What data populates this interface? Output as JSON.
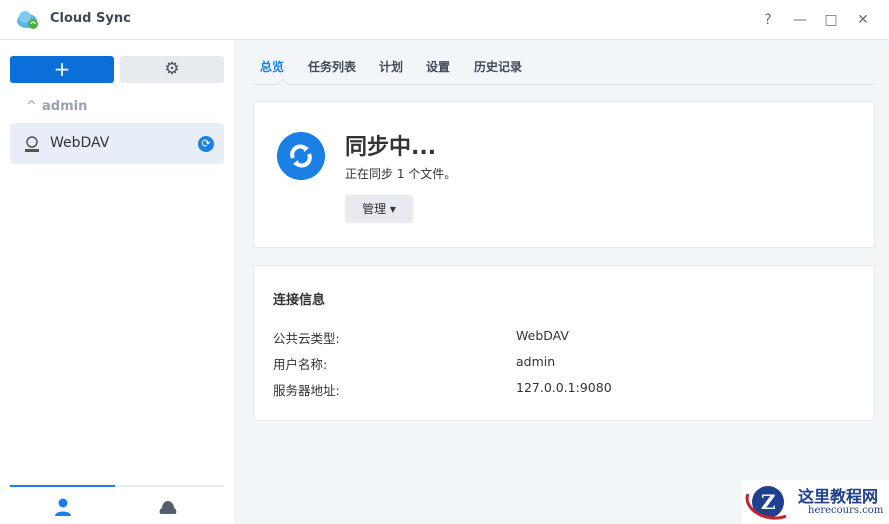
{
  "app": {
    "title": "Cloud Sync"
  },
  "window": {
    "help": "?",
    "minimize": "—",
    "maximize": "□",
    "close": "✕"
  },
  "sidebar": {
    "add_label": "+",
    "settings_label": "⚙",
    "group": "admin",
    "items": [
      {
        "label": "WebDAV",
        "status": "syncing"
      }
    ]
  },
  "tabs": [
    "总览",
    "任务列表",
    "计划",
    "设置",
    "历史记录"
  ],
  "overview": {
    "status": "同步中...",
    "detail": "正在同步 1 个文件。",
    "manage_label": "管理 ▾"
  },
  "connection": {
    "title": "连接信息",
    "rows": [
      {
        "label": "公共云类型:",
        "value": "WebDAV"
      },
      {
        "label": "用户名称:",
        "value": "admin"
      },
      {
        "label": "服务器地址:",
        "value": "127.0.0.1:9080"
      }
    ]
  },
  "watermark": {
    "title": "这里教程网",
    "url": "herecours.com"
  },
  "colors": {
    "accent": "#1a80e5",
    "primary_button": "#0a6fd8"
  }
}
